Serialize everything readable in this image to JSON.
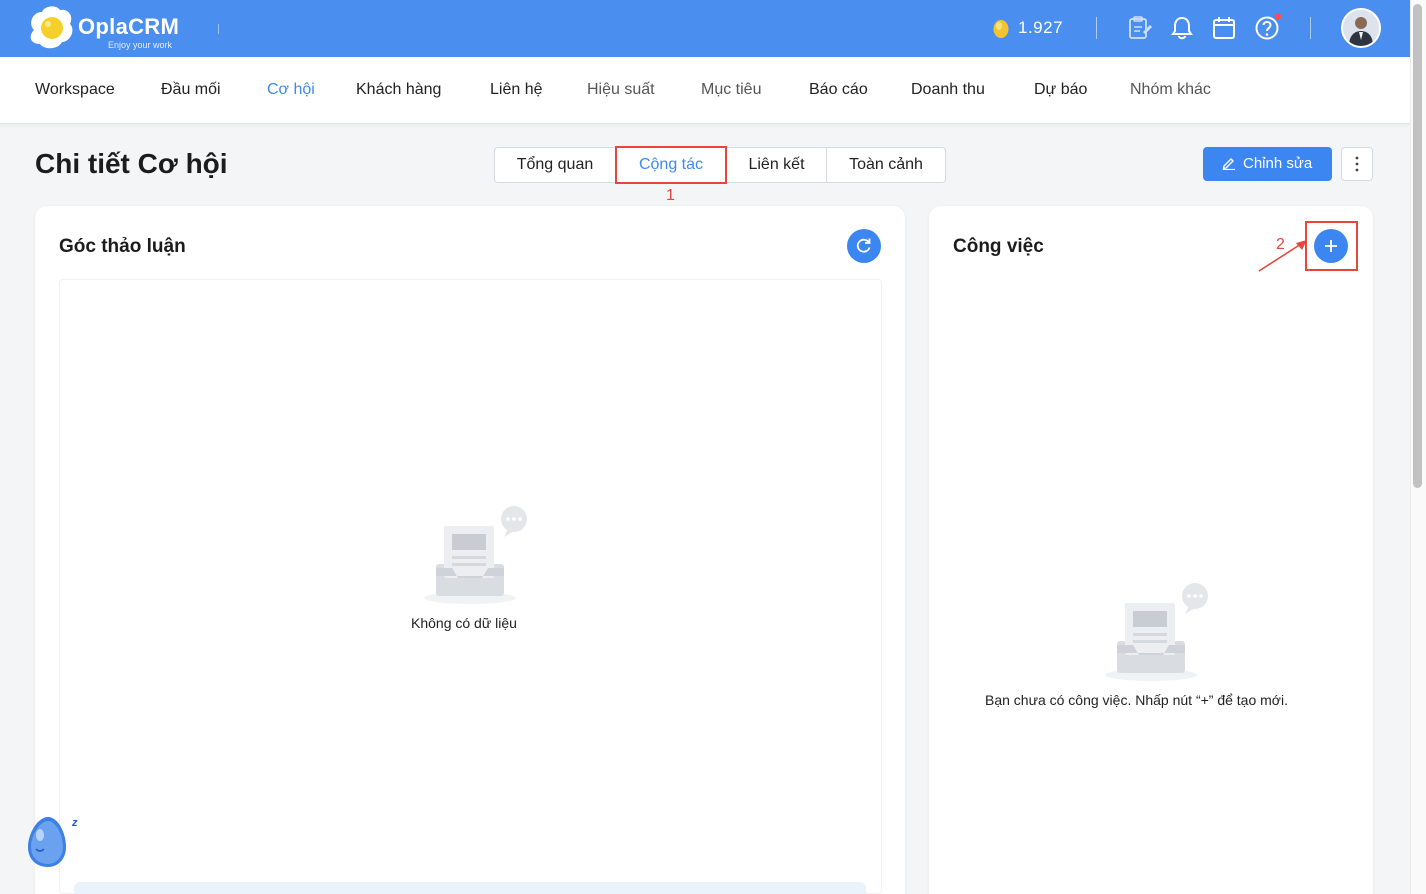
{
  "app": {
    "logo_name": "OplaCRM",
    "logo_tagline": "Enjoy your work",
    "coin_balance": "1.927",
    "brand_color": "#4a8ef0",
    "accent_color": "#3b86f0",
    "annotation_color": "#e8453c"
  },
  "topbar": {
    "icons": [
      "coin-icon",
      "clipboard-icon",
      "bell-icon",
      "calendar-icon",
      "help-icon",
      "avatar"
    ]
  },
  "nav": {
    "items": [
      {
        "label": "Workspace"
      },
      {
        "label": "Đầu mối"
      },
      {
        "label": "Cơ hội"
      },
      {
        "label": "Khách hàng"
      },
      {
        "label": "Liên hệ"
      },
      {
        "label": "Hiệu suất"
      },
      {
        "label": "Mục tiêu"
      },
      {
        "label": "Báo cáo"
      },
      {
        "label": "Doanh thu"
      },
      {
        "label": "Dự báo"
      },
      {
        "label": "Nhóm khác"
      }
    ],
    "active": "Cơ hội"
  },
  "page": {
    "title": "Chi tiết Cơ hội",
    "tabs": [
      {
        "label": "Tổng quan"
      },
      {
        "label": "Cộng tác"
      },
      {
        "label": "Liên kết"
      },
      {
        "label": "Toàn cảnh"
      }
    ],
    "active_tab": "Cộng tác",
    "edit_label": "Chỉnh sửa",
    "step1_label": "1",
    "step2_label": "2"
  },
  "discussion": {
    "title": "Góc thảo luận",
    "empty_text": "Không có dữ liệu"
  },
  "tasks": {
    "title": "Công việc",
    "empty_text": "Bạn chưa có công việc. Nhấp nút “+” để tạo mới."
  },
  "widget": {
    "z_label": "z"
  }
}
